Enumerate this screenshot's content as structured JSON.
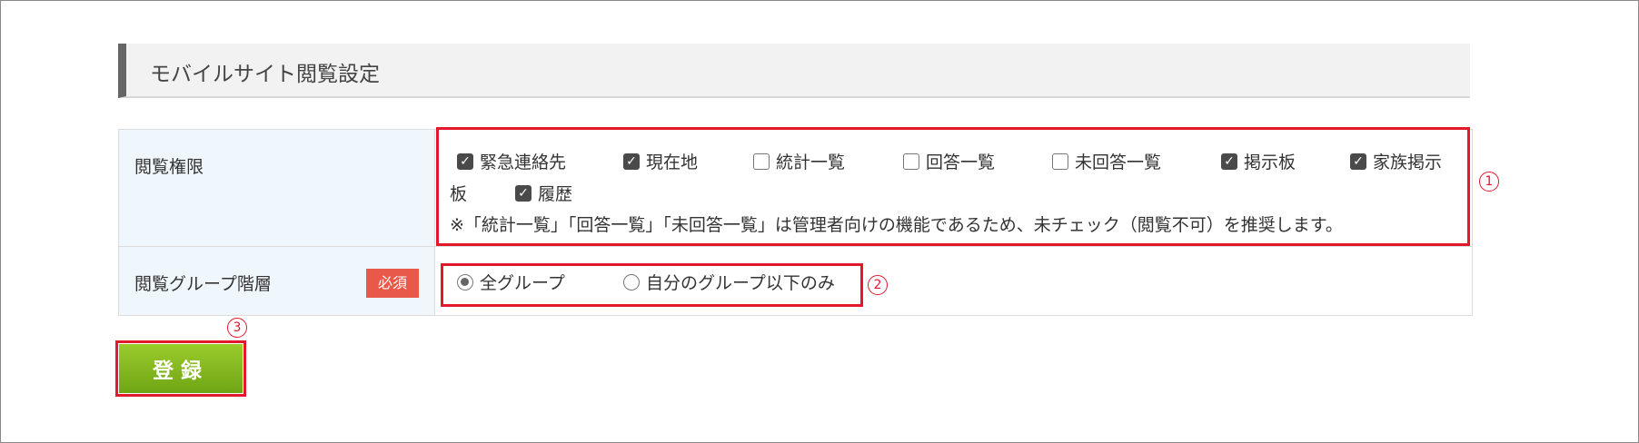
{
  "section": {
    "title": "モバイルサイト閲覧設定"
  },
  "form": {
    "permission": {
      "label": "閲覧権限",
      "checkboxes": [
        {
          "label": "緊急連絡先",
          "checked": true
        },
        {
          "label": "現在地",
          "checked": true
        },
        {
          "label": "統計一覧",
          "checked": false
        },
        {
          "label": "回答一覧",
          "checked": false
        },
        {
          "label": "未回答一覧",
          "checked": false
        },
        {
          "label": "掲示板",
          "checked": true
        },
        {
          "label": "家族掲示",
          "checked": true
        },
        {
          "label": "履歴",
          "checked": true
        }
      ],
      "wrap_text": "板",
      "note": "※「統計一覧」「回答一覧」「未回答一覧」は管理者向けの機能であるため、未チェック（閲覧不可）を推奨します。"
    },
    "group_level": {
      "label": "閲覧グループ階層",
      "required_badge": "必須",
      "options": [
        {
          "label": "全グループ",
          "selected": true
        },
        {
          "label": "自分のグループ以下のみ",
          "selected": false
        }
      ]
    }
  },
  "annotations": [
    "1",
    "2",
    "3"
  ],
  "submit": {
    "label": "登録"
  },
  "colors": {
    "annotation": "#e2182c",
    "button": "#7fb51c",
    "badge": "#e8594a",
    "label_bg": "#f0f7fc"
  }
}
